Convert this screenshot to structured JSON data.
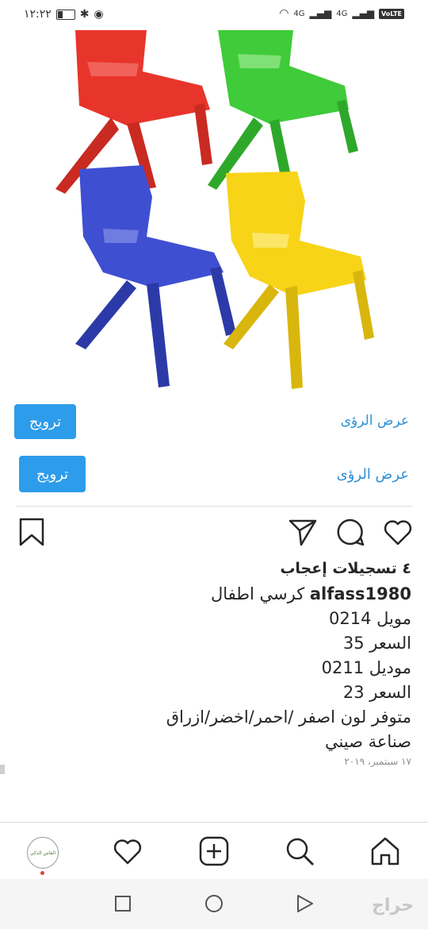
{
  "status_bar": {
    "time": "١٢:٢٢",
    "network_1": "4G",
    "network_2": "4G",
    "volte": "VoLTE"
  },
  "post": {
    "image_alt": "كرسي اطفال",
    "promote_label": "ترويج",
    "insights_label": "عرض الرؤى",
    "likes": "٤ تسجيلات إعجاب",
    "username": "alfass1980",
    "caption_first": "كرسي اطفال",
    "caption_lines": [
      "مويل 0214",
      "السعر 35",
      "موديل 0211",
      "السعر 23",
      "متوفر لون اصفر /احمر/اخضر/ازراق",
      "صناعة صيني"
    ],
    "date": "١٧ سبتمبر، ٢٠١٩"
  },
  "profile": {
    "avatar_text": "الفاس الذكي"
  },
  "watermark": "حراج",
  "colors": {
    "accent": "#2d9cea",
    "link": "#2d8fd6",
    "chair_red": "#e8352b",
    "chair_green": "#3fcb3a",
    "chair_blue": "#3f4fd1",
    "chair_yellow": "#f7d417"
  }
}
